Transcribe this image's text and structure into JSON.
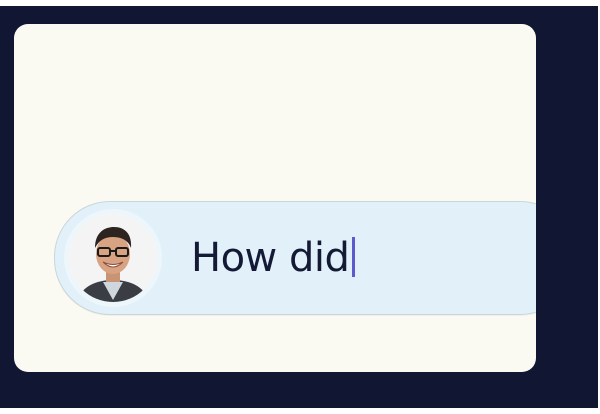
{
  "composer": {
    "avatar_icon": "user-avatar-photo",
    "typed_text": "How did"
  },
  "colors": {
    "outer_frame": "#111733",
    "card": "#fbfaf2",
    "composer": "#e2f1f9",
    "text": "#141a35",
    "caret": "#5d5acd"
  }
}
